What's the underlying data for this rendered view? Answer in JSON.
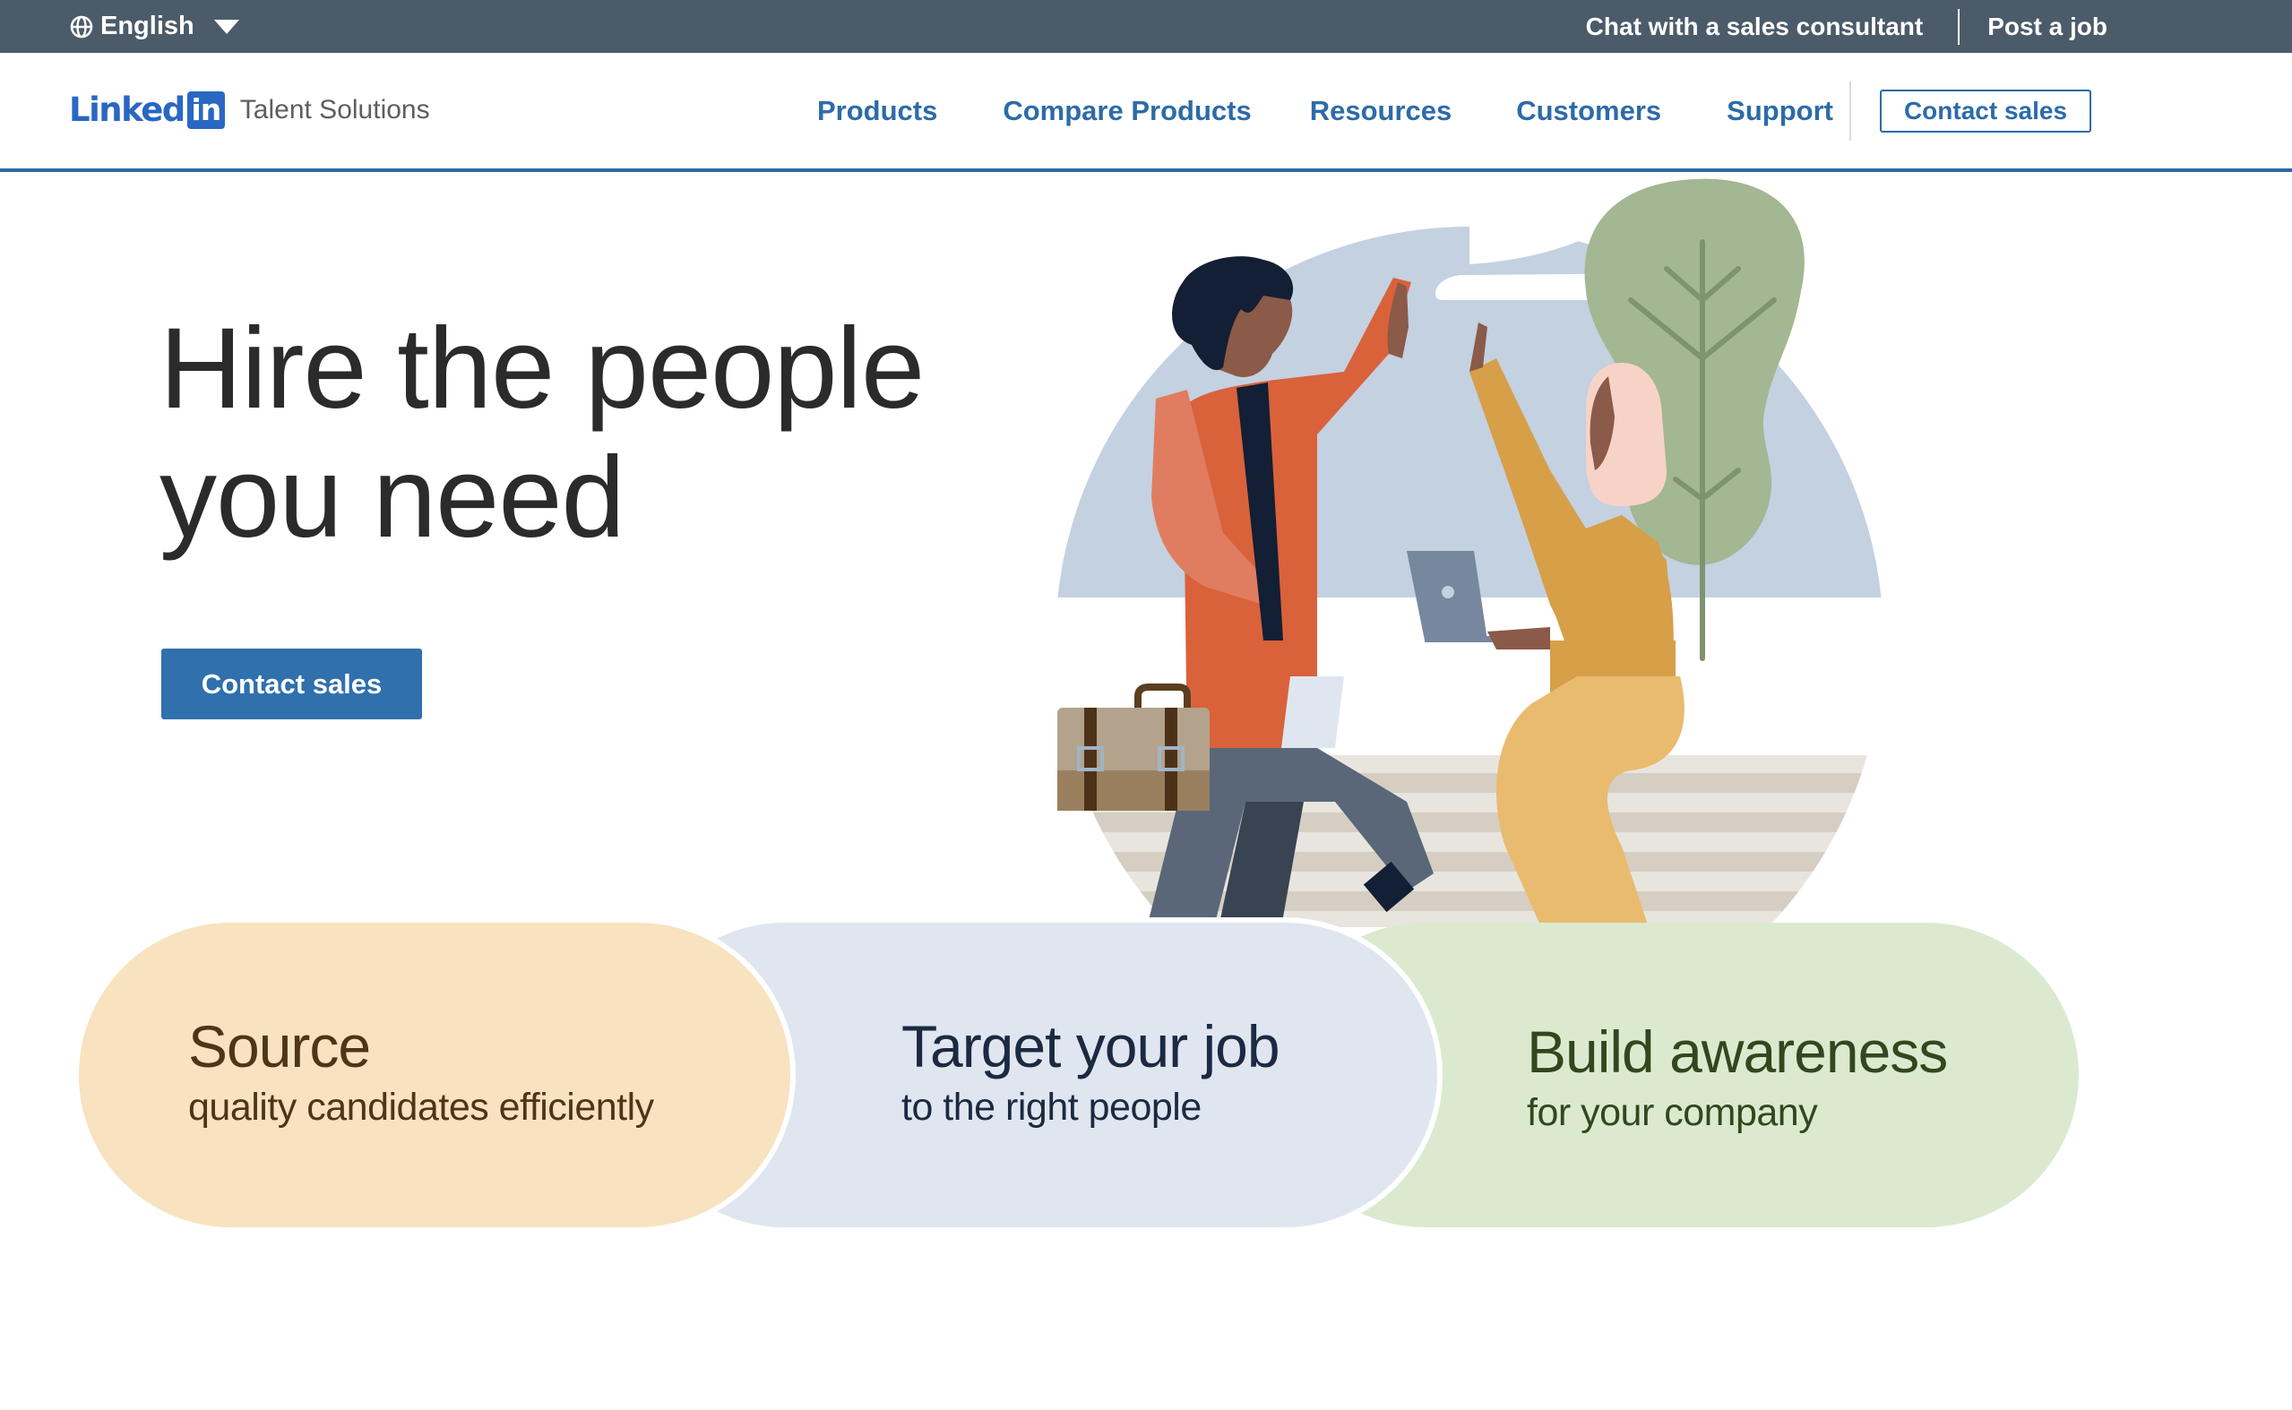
{
  "topbar": {
    "language": "English",
    "links": [
      "Chat with a sales consultant",
      "Post a job"
    ]
  },
  "nav": {
    "logo_word": "Linked",
    "logo_in": "in",
    "logo_sub": "Talent Solutions",
    "items": [
      "Products",
      "Compare Products",
      "Resources",
      "Customers",
      "Support"
    ],
    "cta": "Contact sales"
  },
  "hero": {
    "headline_line1": "Hire the people",
    "headline_line2": "you need",
    "cta": "Contact sales",
    "illustration": "two-people-high-five-illustration"
  },
  "cards": [
    {
      "title": "Source",
      "subtitle": "quality candidates efficiently",
      "color": "#f8e2c0"
    },
    {
      "title": "Target your job",
      "subtitle": "to the right people",
      "color": "#dfe6f0"
    },
    {
      "title": "Build awareness",
      "subtitle": "for your company",
      "color": "#dbeacf"
    }
  ],
  "colors": {
    "topbar": "#4b5b69",
    "brand_blue": "#2a67c3",
    "nav_link": "#2d6ba8",
    "cta_blue": "#2f70ad"
  }
}
